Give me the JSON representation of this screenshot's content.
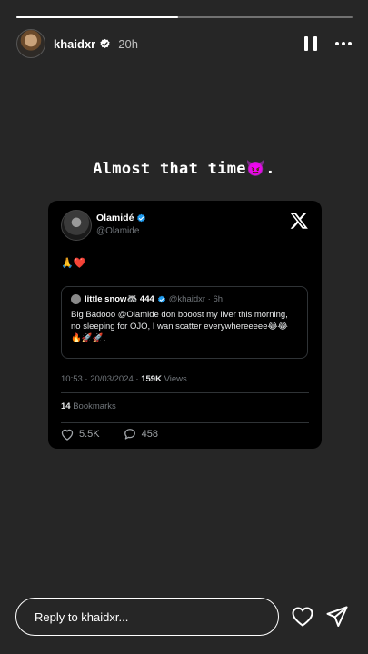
{
  "story": {
    "progress": 0.48,
    "username": "khaidxr",
    "time_ago": "20h",
    "caption": "Almost that time😈."
  },
  "tweet": {
    "author_name": "Olamidé",
    "author_handle": "@Olamide",
    "body": "🙏❤️",
    "quote": {
      "author_name": "little snow🦝 444",
      "author_handle": "@khaidxr · 6h",
      "text": "Big Badooo @Olamide don booost my liver this morning, no sleeping for OJO, I wan scatter everywhereeeee😂😂🔥🚀🚀."
    },
    "timestamp": "10:53 · 20/03/2024 · ",
    "views_count": "159K",
    "views_label": " Views",
    "bookmarks_count": "14",
    "bookmarks_label": " Bookmarks",
    "likes": "5.5K",
    "replies": "458"
  },
  "reply": {
    "placeholder": "Reply to khaidxr..."
  },
  "colors": {
    "background": "#262626",
    "card": "#000000",
    "verified": "#1d9bf0",
    "muted": "#71767b"
  },
  "icons": [
    "verified-badge-icon",
    "pause-icon",
    "more-icon",
    "x-logo-icon",
    "heart-outline-icon",
    "comment-icon",
    "send-icon"
  ]
}
